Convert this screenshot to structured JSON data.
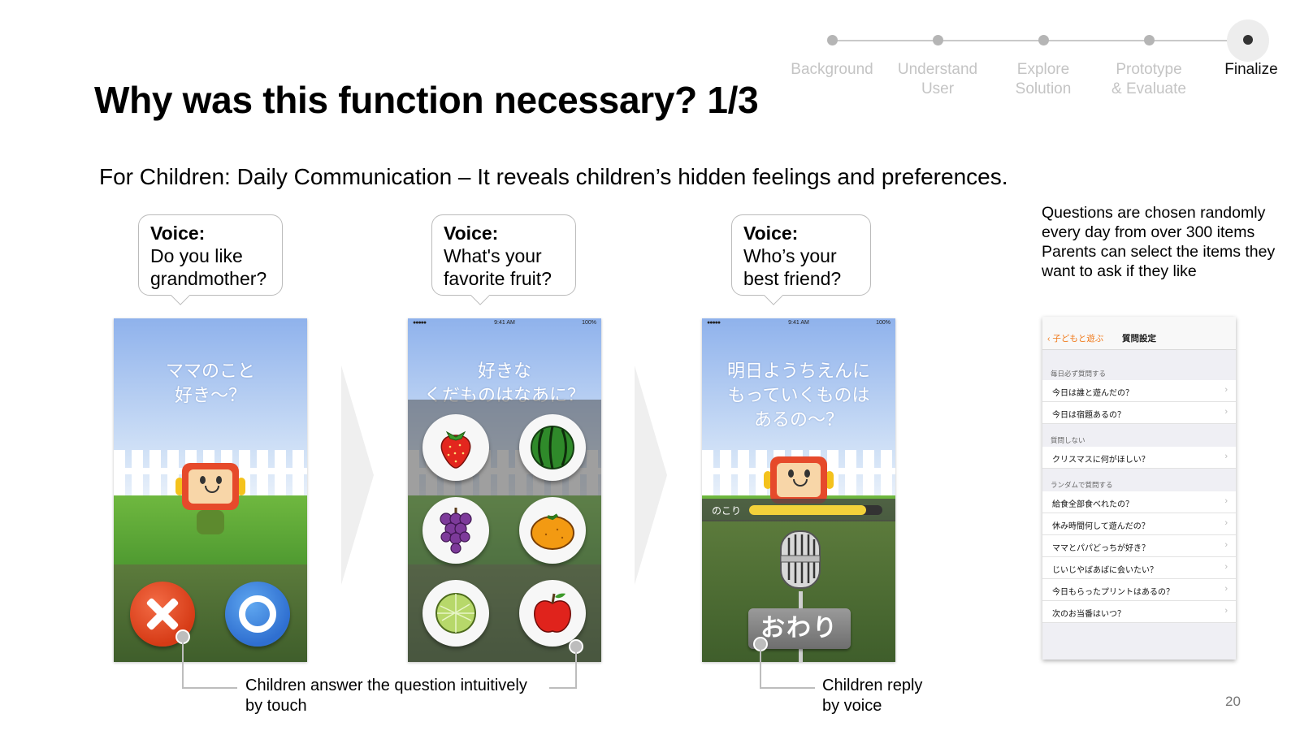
{
  "progress": {
    "steps": [
      {
        "label_lines": [
          "Background"
        ],
        "active": false
      },
      {
        "label_lines": [
          "Understand",
          "User"
        ],
        "active": false
      },
      {
        "label_lines": [
          "Explore",
          "Solution"
        ],
        "active": false
      },
      {
        "label_lines": [
          "Prototype",
          "& Evaluate"
        ],
        "active": false
      },
      {
        "label_lines": [
          "Finalize"
        ],
        "active": true
      }
    ]
  },
  "title": "Why was this function necessary? 1/3",
  "subtitle": "For Children: Daily Communication – It reveals children’s hidden feelings and preferences.",
  "side_note": {
    "line1": "Questions are chosen randomly every day from over 300 items",
    "line2": "Parents can select the items they want to ask if they like"
  },
  "bubbles": [
    {
      "label": "Voice:",
      "line1": "Do you like",
      "line2": "grandmother?"
    },
    {
      "label": "Voice:",
      "line1": "What's your",
      "line2": "favorite fruit?"
    },
    {
      "label": "Voice:",
      "line1": "Who’s your",
      "line2": "best friend?"
    }
  ],
  "screens": {
    "status_time": "9:41 AM",
    "status_battery": "100%",
    "status_signal": "●●●●● ",
    "s1_question": [
      "ママのこと",
      "好き～？"
    ],
    "s2_question": [
      "好きな",
      "くだものはなあに？"
    ],
    "s3_question": [
      "明日ようちえんに",
      "もっていくものは",
      "あるの～？"
    ],
    "s3_remaining_label": "のこり",
    "s3_remaining_fraction": 0.88,
    "s3_finish_button": "おわり",
    "fruits": [
      "strawberry-icon",
      "watermelon-icon",
      "grapes-icon",
      "orange-icon",
      "melon-icon",
      "apple-icon"
    ]
  },
  "settings_screen": {
    "back": "子どもと遊ぶ",
    "title": "質問設定",
    "sections": [
      {
        "header": "毎日必ず質問する",
        "items": [
          "今日は誰と遊んだの？",
          "今日は宿題あるの？"
        ]
      },
      {
        "header": "質問しない",
        "items": [
          "クリスマスに何がほしい？"
        ]
      },
      {
        "header": "ランダムで質問する",
        "items": [
          "給食全部食べれたの？",
          "休み時間何して遊んだの？",
          "ママとパパどっちが好き？",
          "じいじやばあばに会いたい？",
          "今日もらったプリントはあるの？",
          "次のお当番はいつ？"
        ]
      }
    ],
    "chevron": "›"
  },
  "captions": {
    "touch": [
      "Children answer the question intuitively",
      "by touch"
    ],
    "voice": [
      "Children reply",
      "by voice"
    ]
  },
  "page_number": "20",
  "colors": {
    "accent_orange": "#f07a1c",
    "no_red": "#d63b16",
    "yes_blue": "#2f6fd0"
  }
}
